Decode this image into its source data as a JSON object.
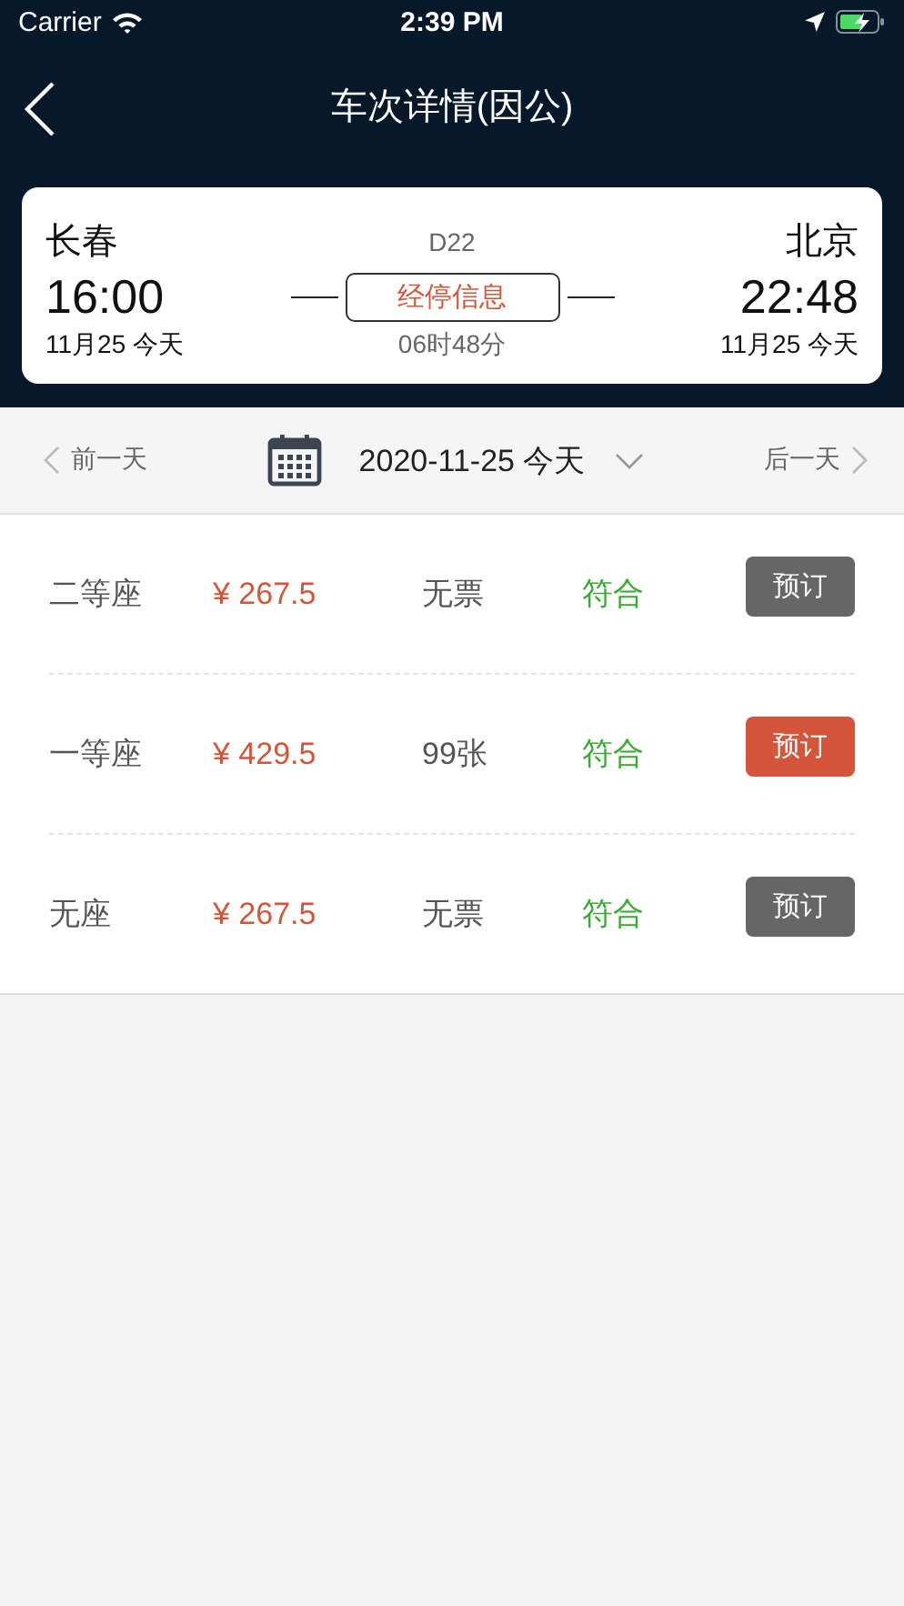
{
  "status_bar": {
    "carrier": "Carrier",
    "time": "2:39 PM"
  },
  "nav": {
    "title": "车次详情(因公)"
  },
  "train": {
    "from_station": "长春",
    "to_station": "北京",
    "train_no": "D22",
    "depart_time": "16:00",
    "arrive_time": "22:48",
    "stops_button": "经停信息",
    "depart_date": "11月25 今天",
    "arrive_date": "11月25 今天",
    "duration": "06时48分"
  },
  "date_bar": {
    "prev": "前一天",
    "date": "2020-11-25 今天",
    "next": "后一天"
  },
  "seats": [
    {
      "name": "二等座",
      "price": "¥ 267.5",
      "tickets": "无票",
      "policy": "符合",
      "button": "预订",
      "disabled": true
    },
    {
      "name": "一等座",
      "price": "¥ 429.5",
      "tickets": "99张",
      "policy": "符合",
      "button": "预订",
      "disabled": false
    },
    {
      "name": "无座",
      "price": "¥ 267.5",
      "tickets": "无票",
      "policy": "符合",
      "button": "预订",
      "disabled": true
    }
  ]
}
